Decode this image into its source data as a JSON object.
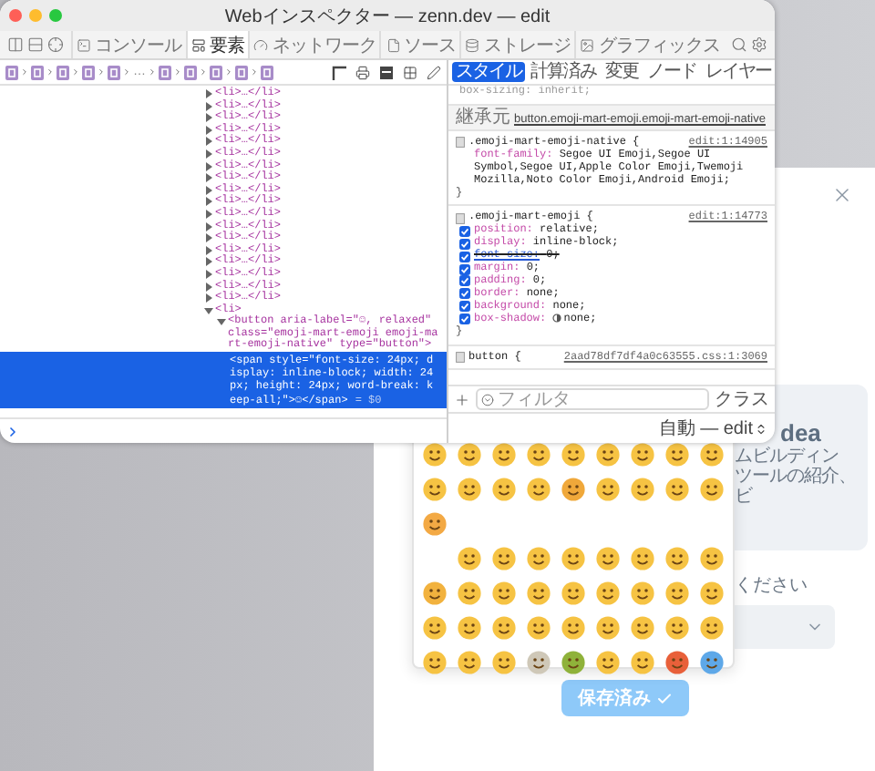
{
  "window": {
    "title": "Webインスペクター — zenn.dev — edit"
  },
  "tabs": [
    {
      "label": "コンソール",
      "selected": false
    },
    {
      "label": "要素",
      "selected": true
    },
    {
      "label": "ネットワーク",
      "selected": false
    },
    {
      "label": "ソース",
      "selected": false
    },
    {
      "label": "ストレージ",
      "selected": false
    },
    {
      "label": "グラフィックス",
      "selected": false
    }
  ],
  "breadcrumb": {
    "ellipsis": "…"
  },
  "dom_tree": [
    {
      "text": "<li>…</li>",
      "expanded": false,
      "selected": false
    },
    {
      "text": "<li>…</li>",
      "expanded": false,
      "selected": false
    },
    {
      "text": "<li>…</li>",
      "expanded": false,
      "selected": false
    },
    {
      "text": "<li>…</li>",
      "expanded": false,
      "selected": false
    },
    {
      "text": "<li>…</li>",
      "expanded": false,
      "selected": false
    },
    {
      "text": "<li>…</li>",
      "expanded": false,
      "selected": false
    },
    {
      "text": "<li>…</li>",
      "expanded": false,
      "selected": false
    },
    {
      "text": "<li>…</li>",
      "expanded": false,
      "selected": false
    },
    {
      "text": "<li>…</li>",
      "expanded": false,
      "selected": false
    },
    {
      "text": "<li>…</li>",
      "expanded": false,
      "selected": false
    },
    {
      "text": "<li>…</li>",
      "expanded": false,
      "selected": false
    },
    {
      "text": "<li>…</li>",
      "expanded": false,
      "selected": false
    },
    {
      "text": "<li>…</li>",
      "expanded": false,
      "selected": false
    },
    {
      "text": "<li>…</li>",
      "expanded": false,
      "selected": false
    },
    {
      "text": "<li>…</li>",
      "expanded": false,
      "selected": false
    },
    {
      "text": "<li>…</li>",
      "expanded": false,
      "selected": false
    },
    {
      "text": "<li>…</li>",
      "expanded": false,
      "selected": false
    },
    {
      "text": "<li>…</li>",
      "expanded": false,
      "selected": false
    },
    {
      "text": "<li>",
      "expanded": true,
      "selected": false,
      "children": [
        {
          "text": "<button aria-label=\"☺, relaxed\" class=\"emoji-mart-emoji emoji-mart-emoji-native\" type=\"button\">",
          "expanded": true,
          "selected": false,
          "children": [
            {
              "text": "<span style=\"font-size: 24px; display: inline-block; width: 24px; height: 24px; word-break: keep-all;\">☺</span>",
              "selected": true,
              "suffix": "= $0"
            }
          ]
        }
      ]
    }
  ],
  "sidebar_tabs": [
    {
      "label": "スタイル",
      "selected": true
    },
    {
      "label": "計算済み",
      "selected": false
    },
    {
      "label": "変更",
      "selected": false
    },
    {
      "label": "ノード",
      "selected": false
    },
    {
      "label": "レイヤー",
      "selected": false
    }
  ],
  "styles": {
    "cut_line": {
      "name": "box-sizing:",
      "value": "inherit;"
    },
    "inherited_label": "継承元",
    "inherited_selector": "button.emoji-mart-emoji.emoji-mart-emoji-native",
    "rules": [
      {
        "selector": ".emoji-mart-emoji-native {",
        "source": "edit:1:14905",
        "close": "}",
        "properties": [
          {
            "kind": "plain",
            "name": "font-family:",
            "value": "Segoe UI Emoji,Segoe UI Symbol,Segoe UI,Apple Color Emoji,Twemoji Mozilla,Noto Color Emoji,Android Emoji;"
          }
        ]
      },
      {
        "selector": ".emoji-mart-emoji {",
        "source": "edit:1:14773",
        "close": "}",
        "properties": [
          {
            "kind": "plain",
            "name": "position:",
            "value": "relative;",
            "checked": true,
            "overridden": false
          },
          {
            "kind": "plain",
            "name": "display:",
            "value": "inline-block;",
            "checked": true,
            "overridden": false
          },
          {
            "kind": "plain",
            "name": "font-size:",
            "value": "0;",
            "checked": true,
            "overridden": true
          },
          {
            "kind": "plain",
            "name": "margin:",
            "value": "0;",
            "checked": true,
            "overridden": false
          },
          {
            "kind": "plain",
            "name": "padding:",
            "value": "0;",
            "checked": true,
            "overridden": false
          },
          {
            "kind": "plain",
            "name": "border:",
            "value": "none;",
            "checked": true,
            "overridden": false
          },
          {
            "kind": "plain",
            "name": "background:",
            "value": "none;",
            "checked": true,
            "overridden": false
          },
          {
            "kind": "shadow",
            "name": "box-shadow:",
            "value": "none;",
            "checked": true,
            "overridden": false
          }
        ]
      },
      {
        "selector": "button {",
        "source": "2aad78df7df4a0c63555.css:1:3069"
      }
    ]
  },
  "filter": {
    "placeholder": "フィルタ",
    "class_button": "クラス"
  },
  "bottom_bar": {
    "target": "自動 — edit"
  },
  "modal": {
    "card": {
      "title": "dea",
      "lines": [
        "ムビルディン",
        "ツールの紹介、",
        "ビ"
      ]
    },
    "field_label": "ください",
    "save_button": {
      "label": "保存済み",
      "disabled": true
    },
    "emoji_rows": [
      [
        {
          "kind": "face",
          "color": "#f6c343"
        },
        {
          "kind": "face",
          "color": "#f6c343"
        },
        {
          "kind": "face",
          "color": "#f6c343"
        },
        {
          "kind": "face",
          "color": "#f6c343"
        },
        {
          "kind": "face",
          "color": "#f6c343"
        },
        {
          "kind": "face",
          "color": "#f6c343"
        },
        {
          "kind": "face",
          "color": "#f6c343"
        },
        {
          "kind": "face",
          "color": "#f6c343"
        },
        {
          "kind": "face",
          "color": "#f6c343"
        }
      ],
      [
        {
          "kind": "face",
          "color": "#f6c343"
        },
        {
          "kind": "face",
          "color": "#f6c343"
        },
        {
          "kind": "face",
          "color": "#f6c343"
        },
        {
          "kind": "face",
          "color": "#f6c343"
        },
        {
          "kind": "face",
          "color": "#f0a83a"
        },
        {
          "kind": "face",
          "color": "#f6c343"
        },
        {
          "kind": "face",
          "color": "#f6c343"
        },
        {
          "kind": "face",
          "color": "#f6c343"
        },
        {
          "kind": "face",
          "color": "#f6c343"
        }
      ],
      [
        {
          "kind": "face",
          "color": "#f3a944"
        }
      ],
      [
        {
          "kind": "gap"
        },
        {
          "kind": "face",
          "color": "#f6c343"
        },
        {
          "kind": "face",
          "color": "#f6c343"
        },
        {
          "kind": "face",
          "color": "#f6c343"
        },
        {
          "kind": "face",
          "color": "#f6c343"
        },
        {
          "kind": "face",
          "color": "#f6c343"
        },
        {
          "kind": "face",
          "color": "#f6c343"
        },
        {
          "kind": "face",
          "color": "#f6c343"
        },
        {
          "kind": "face",
          "color": "#f6c343"
        }
      ],
      [
        {
          "kind": "face",
          "color": "#f2b23e"
        },
        {
          "kind": "face",
          "color": "#f6c343"
        },
        {
          "kind": "face",
          "color": "#f6c343"
        },
        {
          "kind": "face",
          "color": "#f6c343"
        },
        {
          "kind": "face",
          "color": "#f6c343"
        },
        {
          "kind": "face",
          "color": "#f6c343"
        },
        {
          "kind": "face",
          "color": "#f6c343"
        },
        {
          "kind": "face",
          "color": "#f6c343"
        },
        {
          "kind": "face",
          "color": "#f6c343"
        }
      ],
      [
        {
          "kind": "face",
          "color": "#f6c343"
        },
        {
          "kind": "face",
          "color": "#f6c343"
        },
        {
          "kind": "face",
          "color": "#f6c343"
        },
        {
          "kind": "face",
          "color": "#f6c343"
        },
        {
          "kind": "face",
          "color": "#f6c343"
        },
        {
          "kind": "face",
          "color": "#f6c343"
        },
        {
          "kind": "face",
          "color": "#f6c343"
        },
        {
          "kind": "face",
          "color": "#f6c343"
        },
        {
          "kind": "face",
          "color": "#f6c343"
        }
      ],
      [
        {
          "kind": "face",
          "color": "#f6c343"
        },
        {
          "kind": "face",
          "color": "#f6c343"
        },
        {
          "kind": "face",
          "color": "#f6c343"
        },
        {
          "kind": "face",
          "color": "#cfc8b8"
        },
        {
          "kind": "face",
          "color": "#8fb23a"
        },
        {
          "kind": "face",
          "color": "#f6c343"
        },
        {
          "kind": "face",
          "color": "#f6c343"
        },
        {
          "kind": "face",
          "color": "#e8603a"
        },
        {
          "kind": "face",
          "color": "#5ea8e8"
        }
      ]
    ]
  }
}
